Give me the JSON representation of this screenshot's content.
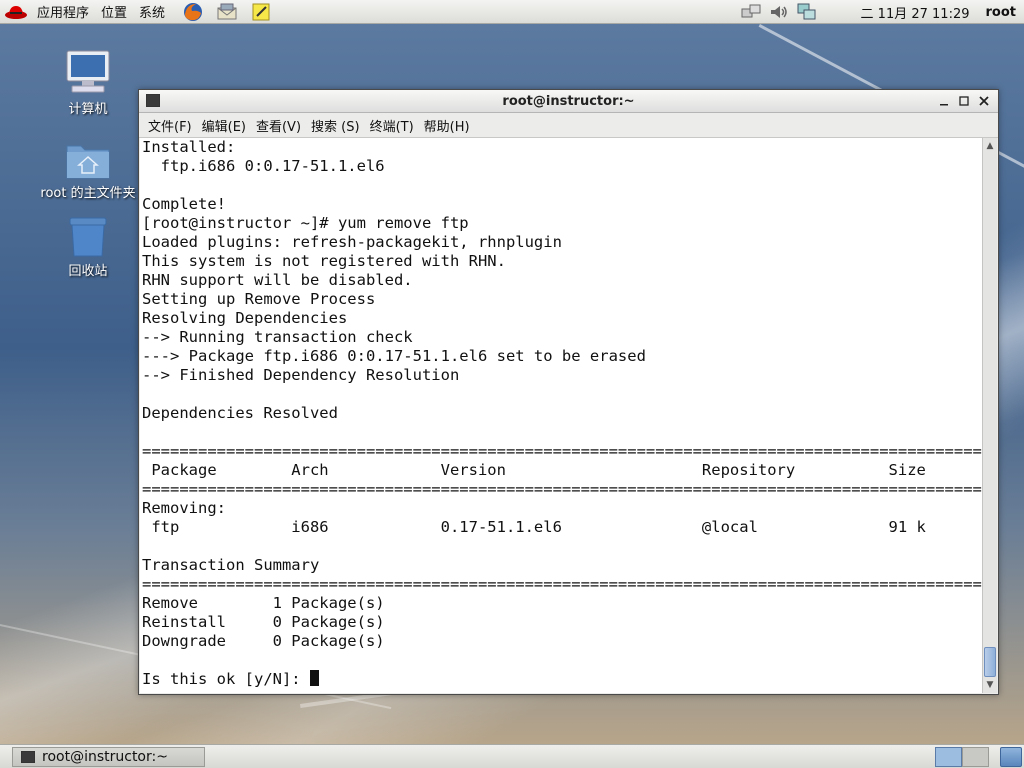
{
  "top_panel": {
    "menus": [
      "应用程序",
      "位置",
      "系统"
    ],
    "clock": "二 11月 27 11:29",
    "user": "root"
  },
  "desktop_icons": [
    {
      "label": "计算机",
      "icon": "computer-icon"
    },
    {
      "label": "root 的主文件夹",
      "icon": "home-folder-icon"
    },
    {
      "label": "回收站",
      "icon": "trash-icon"
    }
  ],
  "window": {
    "title": "root@instructor:~",
    "menus": [
      "文件(F)",
      "编辑(E)",
      "查看(V)",
      "搜索 (S)",
      "终端(T)",
      "帮助(H)"
    ]
  },
  "terminal": {
    "lines": [
      "Installed:",
      "  ftp.i686 0:0.17-51.1.el6",
      "",
      "Complete!",
      "[root@instructor ~]# yum remove ftp",
      "Loaded plugins: refresh-packagekit, rhnplugin",
      "This system is not registered with RHN.",
      "RHN support will be disabled.",
      "Setting up Remove Process",
      "Resolving Dependencies",
      "--> Running transaction check",
      "---> Package ftp.i686 0:0.17-51.1.el6 set to be erased",
      "--> Finished Dependency Resolution",
      "",
      "Dependencies Resolved",
      "",
      "================================================================================================",
      " Package        Arch            Version                     Repository          Size",
      "================================================================================================",
      "Removing:",
      " ftp            i686            0.17-51.1.el6               @local              91 k",
      "",
      "Transaction Summary",
      "================================================================================================",
      "Remove        1 Package(s)",
      "Reinstall     0 Package(s)",
      "Downgrade     0 Package(s)",
      ""
    ],
    "prompt": "Is this ok [y/N]: "
  },
  "taskbar": {
    "task_label": "root@instructor:~"
  }
}
